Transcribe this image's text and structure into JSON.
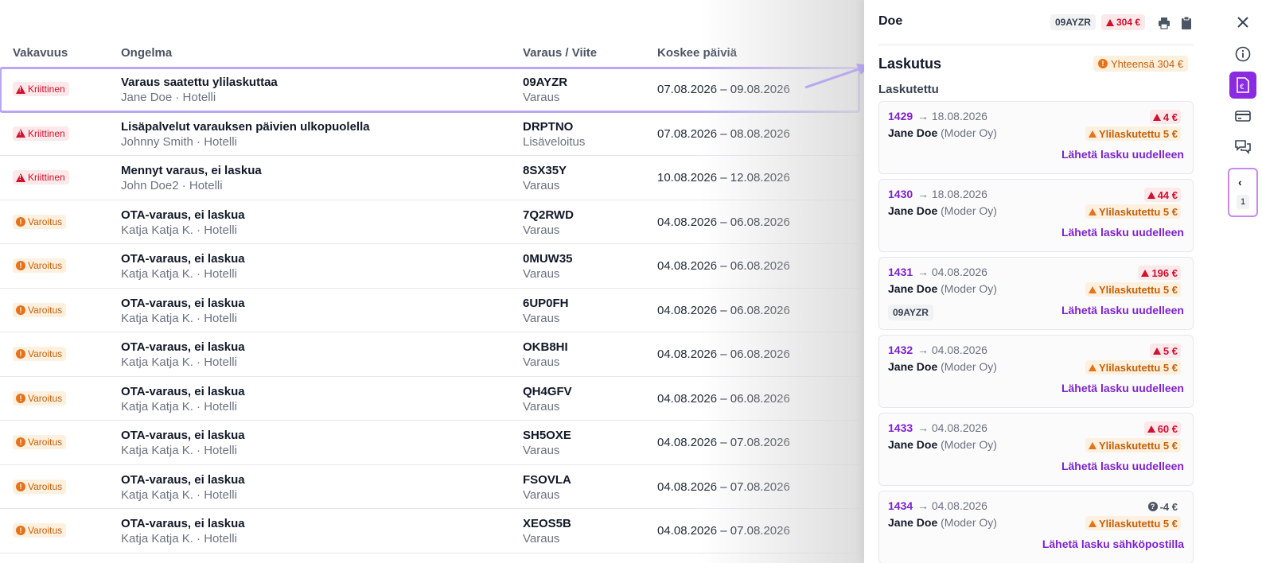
{
  "table": {
    "headers": {
      "severity": "Vakavuus",
      "problem": "Ongelma",
      "reference": "Varaus / Viite",
      "days": "Koskee päiviä"
    },
    "rows": [
      {
        "severity": "Kriittinen",
        "level": "critical",
        "title": "Varaus saatettu ylilaskuttaa",
        "subtitle": "Jane Doe · Hotelli",
        "ref": "09AYZR",
        "ref_type": "Varaus",
        "days": "07.08.2026 – 09.08.2026"
      },
      {
        "severity": "Kriittinen",
        "level": "critical",
        "title": "Lisäpalvelut varauksen päivien ulkopuolella",
        "subtitle": "Johnny Smith · Hotelli",
        "ref": "DRPTNO",
        "ref_type": "Lisäveloitus",
        "days": "07.08.2026 – 08.08.2026"
      },
      {
        "severity": "Kriittinen",
        "level": "critical",
        "title": "Mennyt varaus, ei laskua",
        "subtitle": "John Doe2 · Hotelli",
        "ref": "8SX35Y",
        "ref_type": "Varaus",
        "days": "10.08.2026 – 12.08.2026"
      },
      {
        "severity": "Varoitus",
        "level": "warning",
        "title": "OTA-varaus, ei laskua",
        "subtitle": "Katja Katja K. · Hotelli",
        "ref": "7Q2RWD",
        "ref_type": "Varaus",
        "days": "04.08.2026 – 06.08.2026"
      },
      {
        "severity": "Varoitus",
        "level": "warning",
        "title": "OTA-varaus, ei laskua",
        "subtitle": "Katja Katja K. · Hotelli",
        "ref": "0MUW35",
        "ref_type": "Varaus",
        "days": "04.08.2026 – 06.08.2026"
      },
      {
        "severity": "Varoitus",
        "level": "warning",
        "title": "OTA-varaus, ei laskua",
        "subtitle": "Katja Katja K. · Hotelli",
        "ref": "6UP0FH",
        "ref_type": "Varaus",
        "days": "04.08.2026 – 06.08.2026"
      },
      {
        "severity": "Varoitus",
        "level": "warning",
        "title": "OTA-varaus, ei laskua",
        "subtitle": "Katja Katja K. · Hotelli",
        "ref": "OKB8HI",
        "ref_type": "Varaus",
        "days": "04.08.2026 – 06.08.2026"
      },
      {
        "severity": "Varoitus",
        "level": "warning",
        "title": "OTA-varaus, ei laskua",
        "subtitle": "Katja Katja K. · Hotelli",
        "ref": "QH4GFV",
        "ref_type": "Varaus",
        "days": "04.08.2026 – 06.08.2026"
      },
      {
        "severity": "Varoitus",
        "level": "warning",
        "title": "OTA-varaus, ei laskua",
        "subtitle": "Katja Katja K. · Hotelli",
        "ref": "SH5OXE",
        "ref_type": "Varaus",
        "days": "04.08.2026 – 07.08.2026"
      },
      {
        "severity": "Varoitus",
        "level": "warning",
        "title": "OTA-varaus, ei laskua",
        "subtitle": "Katja Katja K. · Hotelli",
        "ref": "FSOVLA",
        "ref_type": "Varaus",
        "days": "04.08.2026 – 07.08.2026"
      },
      {
        "severity": "Varoitus",
        "level": "warning",
        "title": "OTA-varaus, ei laskua",
        "subtitle": "Katja Katja K. · Hotelli",
        "ref": "XEOS5B",
        "ref_type": "Varaus",
        "days": "04.08.2026 – 07.08.2026"
      }
    ]
  },
  "panel": {
    "name": "Doe",
    "ref_chip": "09AYZR",
    "total_chip": "304 €",
    "section_title": "Laskutus",
    "total_label": "Yhteensä 304 €",
    "subtitle": "Laskutettu",
    "invoices": [
      {
        "number": "1429",
        "date": "→ 18.08.2026",
        "customer": "Jane Doe",
        "company": "(Moder Oy)",
        "amount": "4 €",
        "amount_kind": "alert",
        "overbilled": "Ylilaskutettu 5 €",
        "action": "Lähetä lasku uudelleen",
        "ref": ""
      },
      {
        "number": "1430",
        "date": "→ 18.08.2026",
        "customer": "Jane Doe",
        "company": "(Moder Oy)",
        "amount": "44 €",
        "amount_kind": "alert",
        "overbilled": "Ylilaskutettu 5 €",
        "action": "Lähetä lasku uudelleen",
        "ref": ""
      },
      {
        "number": "1431",
        "date": "→ 04.08.2026",
        "customer": "Jane Doe",
        "company": "(Moder Oy)",
        "amount": "196 €",
        "amount_kind": "alert",
        "overbilled": "Ylilaskutettu 5 €",
        "action": "Lähetä lasku uudelleen",
        "ref": "09AYZR"
      },
      {
        "number": "1432",
        "date": "→ 04.08.2026",
        "customer": "Jane Doe",
        "company": "(Moder Oy)",
        "amount": "5 €",
        "amount_kind": "alert",
        "overbilled": "Ylilaskutettu 5 €",
        "action": "Lähetä lasku uudelleen",
        "ref": ""
      },
      {
        "number": "1433",
        "date": "→ 04.08.2026",
        "customer": "Jane Doe",
        "company": "(Moder Oy)",
        "amount": "60 €",
        "amount_kind": "alert",
        "overbilled": "Ylilaskutettu 5 €",
        "action": "Lähetä lasku uudelleen",
        "ref": ""
      },
      {
        "number": "1434",
        "date": "→ 04.08.2026",
        "customer": "Jane Doe",
        "company": "(Moder Oy)",
        "amount": "-4 €",
        "amount_kind": "unknown",
        "overbilled": "Ylilaskutettu 5 €",
        "action": "Lähetä lasku sähköpostilla",
        "ref": ""
      }
    ]
  },
  "rail": {
    "icons": [
      "close-icon",
      "info-icon",
      "invoice-euro-icon",
      "credit-card-icon",
      "chat-icon"
    ],
    "collapse_count": "1"
  },
  "colors": {
    "accent": "#8a2be2",
    "critical": "#d0102e",
    "warning": "#c4610a",
    "highlight": "#b7a8f2"
  }
}
